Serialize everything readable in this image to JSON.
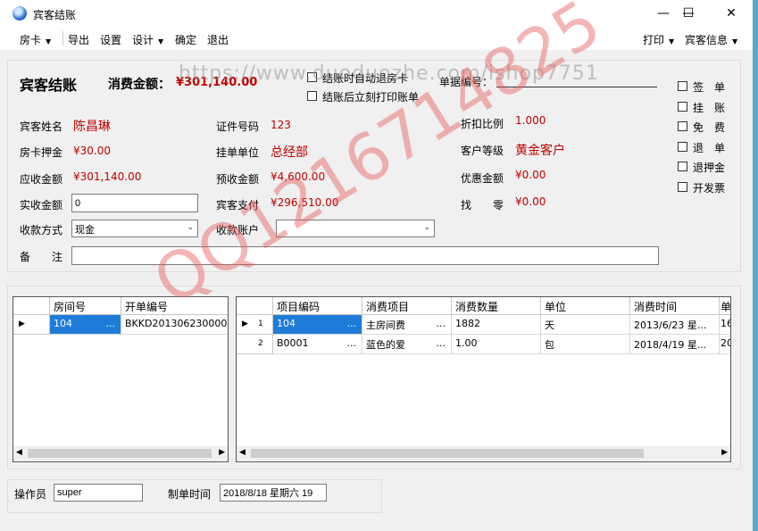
{
  "window": {
    "title": "宾客结账",
    "minimize": "—",
    "maximize": "☐",
    "close": "✕"
  },
  "menu": {
    "room_card": "房卡",
    "export": "导出",
    "settings": "设置",
    "design": "设计",
    "confirm": "确定",
    "exit": "退出",
    "print": "打印",
    "guest_info": "宾客信息",
    "caret": "▼"
  },
  "header": {
    "title": "宾客结账",
    "amount_label": "消费金额：",
    "amount_value": "¥301,140.00",
    "auto_refund_label": "结账时自动退房卡",
    "print_after_label": "结账后立刻打印账单",
    "bill_no_label": "单据编号："
  },
  "right_checks": [
    "签　单",
    "挂　账",
    "免　费",
    "退　单",
    "退押金",
    "开发票"
  ],
  "fields": {
    "guest_name_label": "宾客姓名",
    "guest_name": "陈昌琳",
    "id_no_label": "证件号码",
    "id_no": "123",
    "discount_label": "折扣比例",
    "discount": "1.000",
    "deposit_label": "房卡押金",
    "deposit": "¥30.00",
    "unit_label": "挂单单位",
    "unit": "总经部",
    "level_label": "客户等级",
    "level": "黄金客户",
    "receivable_label": "应收金额",
    "receivable": "¥301,140.00",
    "prepaid_label": "预收金额",
    "prepaid": "¥4,600.00",
    "discount_amt_label": "优惠金额",
    "discount_amt": "¥0.00",
    "actual_label": "实收金额",
    "actual": "0",
    "guest_pay_label": "宾客支付",
    "guest_pay": "¥296,510.00",
    "change_label": "找　　零",
    "change": "¥0.00",
    "pay_method_label": "收款方式",
    "pay_method": "现金",
    "account_label": "收款账户",
    "account": "",
    "remark_label": "备　　注",
    "remark": ""
  },
  "room_grid": {
    "headers": [
      "房间号",
      "开单编号"
    ],
    "rows": [
      {
        "room": "104",
        "room_more": "...",
        "bill": "BKKD201306230000..."
      }
    ]
  },
  "item_grid": {
    "headers": [
      "项目编码",
      "消费项目",
      "消费数量",
      "单位",
      "消费时间",
      "单"
    ],
    "rows": [
      {
        "no": "1",
        "code": "104",
        "code_more": "...",
        "item": "主房间费",
        "item_more": "...",
        "qty": "1882",
        "unit": "天",
        "time": "2013/6/23 星...",
        "extra": "16"
      },
      {
        "no": "2",
        "code": "B0001",
        "code_more": "...",
        "item": "蓝色的爱",
        "item_more": "...",
        "qty": "1.00",
        "unit": "包",
        "time": "2018/4/19 星...",
        "extra": "20"
      }
    ]
  },
  "footer": {
    "operator_label": "操作员",
    "operator": "super",
    "time_label": "制单时间",
    "time": "2018/8/18 星期六 19"
  },
  "watermarks": {
    "url": "https://www.duoduozhe.com/ishop7751",
    "qq": "QQ1216714825"
  }
}
